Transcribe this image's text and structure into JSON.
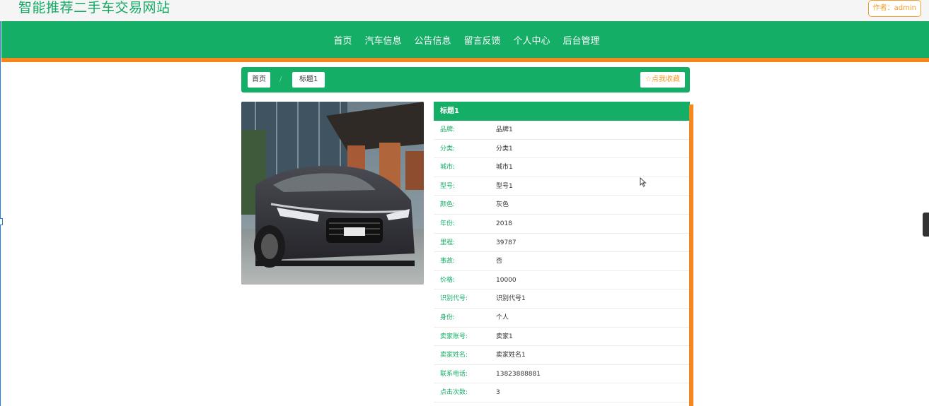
{
  "header": {
    "site_title": "智能推荐二手车交易网站",
    "author": "作者：admin"
  },
  "nav": {
    "items": [
      "首页",
      "汽车信息",
      "公告信息",
      "留言反馈",
      "个人中心",
      "后台管理"
    ]
  },
  "breadcrumb": {
    "home": "首页",
    "separator": "/",
    "current": "标题1"
  },
  "favorite_button": "☆点我收藏",
  "detail": {
    "title": "标题1",
    "fields": [
      {
        "label": "品牌:",
        "value": "品牌1"
      },
      {
        "label": "分类:",
        "value": "分类1"
      },
      {
        "label": "城市:",
        "value": "城市1"
      },
      {
        "label": "型号:",
        "value": "型号1"
      },
      {
        "label": "颜色:",
        "value": "灰色"
      },
      {
        "label": "年份:",
        "value": "2018"
      },
      {
        "label": "里程:",
        "value": "39787"
      },
      {
        "label": "事故:",
        "value": "否"
      },
      {
        "label": "价格:",
        "value": "10000"
      },
      {
        "label": "识别代号:",
        "value": "识别代号1"
      },
      {
        "label": "身份:",
        "value": "个人"
      },
      {
        "label": "卖家账号:",
        "value": "卖家1"
      },
      {
        "label": "卖家姓名:",
        "value": "卖家姓名1"
      },
      {
        "label": "联系电话:",
        "value": "13823888881"
      },
      {
        "label": "点击次数:",
        "value": "3"
      }
    ]
  },
  "colors": {
    "primary_green": "#14ae67",
    "accent_orange": "#f5871f"
  }
}
